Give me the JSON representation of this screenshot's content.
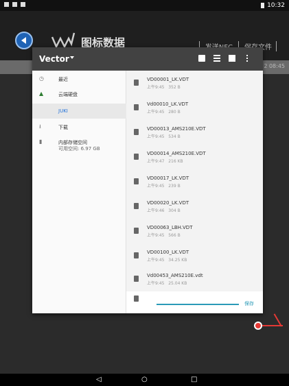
{
  "status": {
    "time": "10:32"
  },
  "app": {
    "title": "图标数据",
    "actions": [
      "发送NFC",
      "保存文件"
    ],
    "timestamp_partial": "2 08:45"
  },
  "dialog": {
    "title": "Vector",
    "sidebar": [
      {
        "label": "最近",
        "icon": "clock-icon"
      },
      {
        "label": "云端硬盘",
        "icon": "drive-icon"
      },
      {
        "label": "JUKI",
        "icon": "",
        "selected": true
      },
      {
        "label": "下载",
        "icon": "download-icon"
      },
      {
        "label": "内部存储空间",
        "sub": "可用空间: 6.97 GB",
        "icon": "sd-card-icon"
      }
    ],
    "files": [
      {
        "name": "VD00001_LK.VDT",
        "time": "上午9:45",
        "size": "352 B"
      },
      {
        "name": "Vd00010_LK.VDT",
        "time": "上午9:45",
        "size": "280 B"
      },
      {
        "name": "VD00013_AMS210E.VDT",
        "time": "上午9:45",
        "size": "534 B"
      },
      {
        "name": "VD00014_AMS210E.VDT",
        "time": "上午9:47",
        "size": "216 KB"
      },
      {
        "name": "VD00017_LK.VDT",
        "time": "上午9:45",
        "size": "239 B"
      },
      {
        "name": "VD00020_LK.VDT",
        "time": "上午9:46",
        "size": "304 B"
      },
      {
        "name": "VD00063_LBH.VDT",
        "time": "上午9:45",
        "size": "566 B"
      },
      {
        "name": "VD00100_LK.VDT",
        "time": "上午9:45",
        "size": "34.25 KB"
      },
      {
        "name": "Vd00453_AMS210E.vdt",
        "time": "上午9:45",
        "size": "25.04 KB"
      }
    ],
    "save_label": "保存"
  },
  "colors": {
    "accent": "#2a9ab7",
    "annotation": "#e53935",
    "toolbar": "#424242"
  }
}
